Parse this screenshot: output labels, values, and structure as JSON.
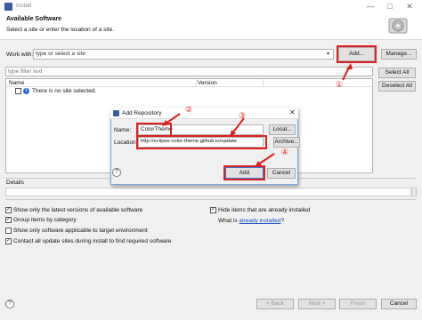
{
  "window": {
    "title": "Install",
    "minimize": "—",
    "maximize": "□",
    "close": "✕"
  },
  "header": {
    "title": "Available Software",
    "subtitle": "Select a site or enter the location of a site."
  },
  "work_with": {
    "label": "Work with:",
    "placeholder": "type or select a site",
    "add_label": "Add...",
    "manage_label": "Manage..."
  },
  "filter": {
    "placeholder": "type filter text"
  },
  "buttons": {
    "select_all": "Select All",
    "deselect_all": "Deselect All"
  },
  "table": {
    "columns": [
      "Name",
      "Version"
    ],
    "rows": [
      {
        "name": "There is no site selected.",
        "version": ""
      }
    ]
  },
  "details": {
    "label": "Details"
  },
  "options": {
    "left": [
      {
        "label": "Show only the latest versions of available software",
        "checked": true
      },
      {
        "label": "Group items by category",
        "checked": true
      },
      {
        "label": "Show only software applicable to target environment",
        "checked": false
      },
      {
        "label": "Contact all update sites during install to find required software",
        "checked": true
      }
    ],
    "hide_installed": {
      "label": "Hide items that are already installed",
      "checked": true
    },
    "what_is": "What is",
    "already_installed_link": "already installed",
    "what_is_suffix": "?"
  },
  "footer": {
    "back": "< Back",
    "next": "Next >",
    "finish": "Finish",
    "cancel": "Cancel"
  },
  "dialog": {
    "title": "Add Repository",
    "name_label": "Name:",
    "name_value": "ColorTheme",
    "local_label": "Local...",
    "location_label": "Location:",
    "location_value": "http://eclipse-color-theme.github.io/update",
    "archive_label": "Archive...",
    "help": "?",
    "add_label": "Add",
    "cancel_label": "Cancel"
  },
  "annotations": {
    "step1": "①",
    "step2": "②",
    "step3": "③",
    "step4": "④",
    "color": "#e02020"
  }
}
